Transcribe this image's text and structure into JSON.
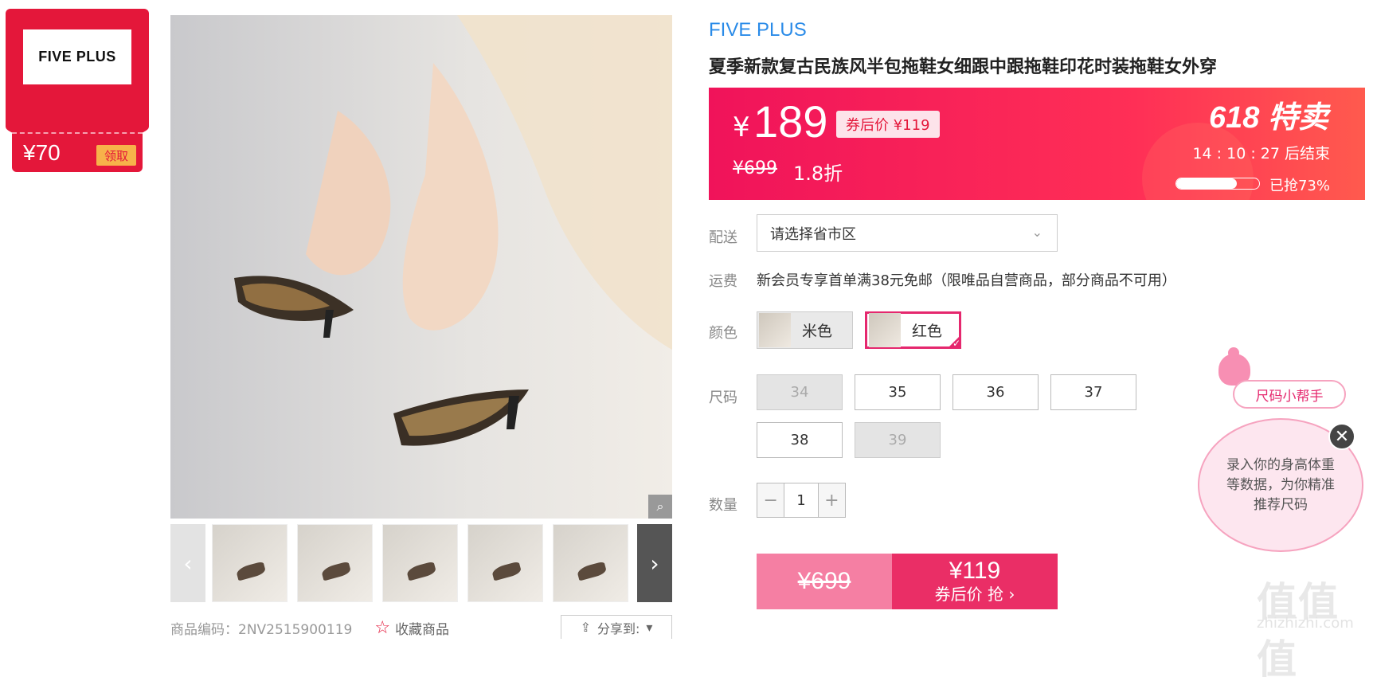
{
  "coupon": {
    "brand": "FIVE PLUS",
    "amount": "¥70",
    "claim_label": "领取"
  },
  "gallery": {
    "prev_label": "‹",
    "next_label": "›",
    "thumbnails": 6
  },
  "meta": {
    "product_code": "商品编码：2NV2515900119",
    "favorite_label": "收藏商品",
    "share_label": "分享到:"
  },
  "product": {
    "brand": "FIVE PLUS",
    "title": "夏季新款复古民族风半包拖鞋女细跟中跟拖鞋印花时装拖鞋女外穿"
  },
  "price_band": {
    "yen": "¥",
    "price": "189",
    "coupon_price": "券后价 ¥119",
    "original_price": "¥699",
    "discount": "1.8折",
    "promo": "618 特卖",
    "countdown": "14 : 10 : 27  后结束",
    "sold_progress": 0.73,
    "sold_text": "已抢73%"
  },
  "delivery": {
    "label": "配送",
    "placeholder": "请选择省市区"
  },
  "shipping": {
    "label": "运费",
    "text": "新会员专享首单满38元免邮（限唯品自营商品，部分商品不可用）"
  },
  "color": {
    "label": "颜色",
    "options": [
      {
        "name": "米色",
        "selected": false
      },
      {
        "name": "红色",
        "selected": true
      }
    ]
  },
  "size": {
    "label": "尺码",
    "options": [
      {
        "value": "34",
        "available": false
      },
      {
        "value": "35",
        "available": true
      },
      {
        "value": "36",
        "available": true
      },
      {
        "value": "37",
        "available": true
      },
      {
        "value": "38",
        "available": true
      },
      {
        "value": "39",
        "available": false
      }
    ]
  },
  "quantity": {
    "label": "数量",
    "minus": "−",
    "value": "1",
    "plus": "+"
  },
  "buy": {
    "original": "¥699",
    "coupon_price": "¥119",
    "cta": "券后价 抢 ›"
  },
  "size_helper": {
    "tag": "尺码小帮手",
    "message": "录入你的身高体重等数据，为你精准推荐尺码",
    "close": "✕"
  },
  "watermark": {
    "text": "值值值",
    "url": "zhizhizhi.com"
  }
}
